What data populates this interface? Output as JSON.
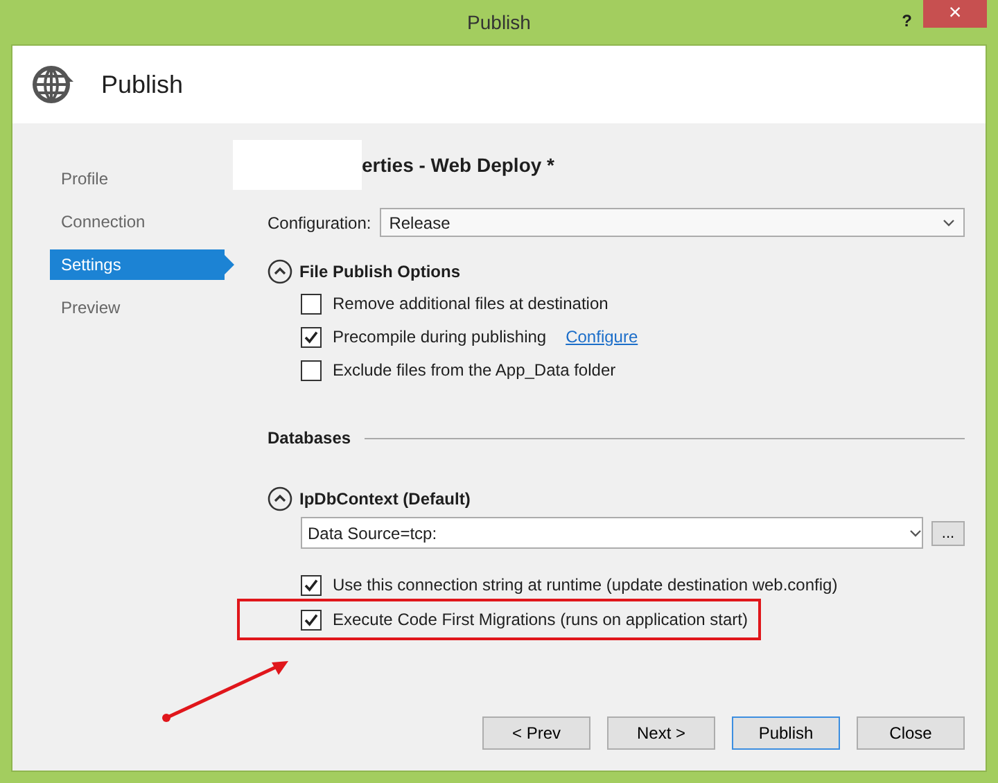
{
  "window": {
    "title": "Publish",
    "help": "?",
    "close": "×"
  },
  "header": {
    "title": "Publish"
  },
  "sidebar": {
    "items": [
      {
        "label": "Profile",
        "selected": false
      },
      {
        "label": "Connection",
        "selected": false
      },
      {
        "label": "Settings",
        "selected": true
      },
      {
        "label": "Preview",
        "selected": false
      }
    ]
  },
  "page_title": "erties - Web Deploy *",
  "configuration": {
    "label": "Configuration:",
    "value": "Release"
  },
  "file_publish_options": {
    "title": "File Publish Options",
    "expanded": true,
    "options": [
      {
        "label": "Remove additional files at destination",
        "checked": false
      },
      {
        "label": "Precompile during publishing",
        "checked": true,
        "link": "Configure"
      },
      {
        "label": "Exclude files from the App_Data folder",
        "checked": false
      }
    ]
  },
  "databases": {
    "title": "Databases",
    "contexts": [
      {
        "title": "IpDbContext (Default)",
        "expanded": true,
        "connection": "Data Source=tcp:",
        "browse": "...",
        "options": [
          {
            "label": "Use this connection string at runtime (update destination web.config)",
            "checked": true,
            "highlighted": false
          },
          {
            "label": "Execute Code First Migrations (runs on application start)",
            "checked": true,
            "highlighted": true
          }
        ]
      }
    ]
  },
  "buttons": [
    {
      "label": "< Prev",
      "default": false
    },
    {
      "label": "Next >",
      "default": false
    },
    {
      "label": "Publish",
      "default": true
    },
    {
      "label": "Close",
      "default": false
    }
  ]
}
